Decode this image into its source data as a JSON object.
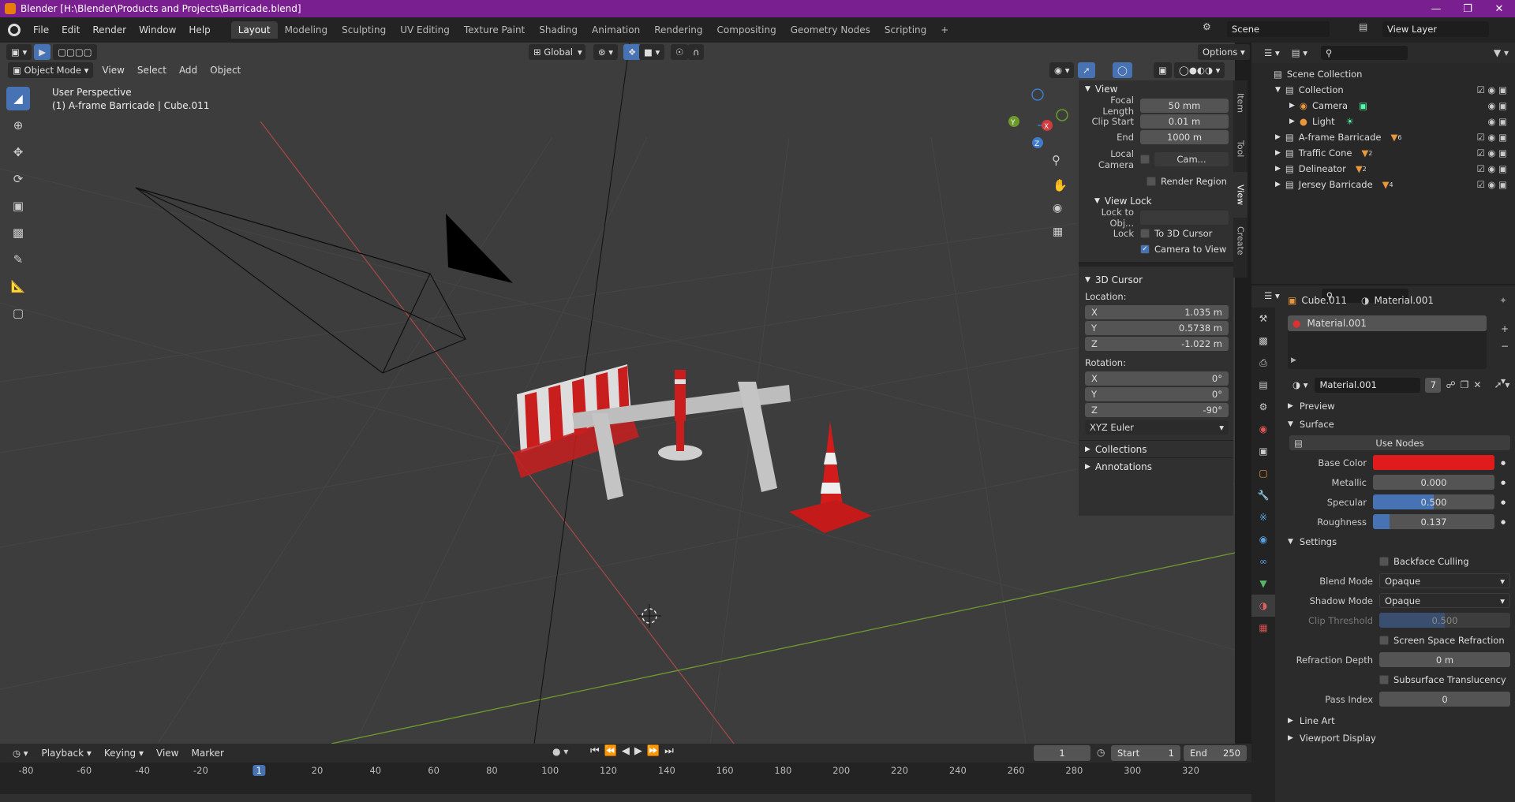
{
  "window": {
    "title": "Blender [H:\\Blender\\Products and Projects\\Barricade.blend]"
  },
  "menu": {
    "items": [
      "File",
      "Edit",
      "Render",
      "Window",
      "Help"
    ]
  },
  "workspaces": {
    "tabs": [
      "Layout",
      "Modeling",
      "Sculpting",
      "UV Editing",
      "Texture Paint",
      "Shading",
      "Animation",
      "Rendering",
      "Compositing",
      "Geometry Nodes",
      "Scripting"
    ],
    "active": "Layout",
    "add": "+"
  },
  "scene": {
    "name": "Scene",
    "view_layer": "View Layer"
  },
  "viewport_header": {
    "transform_orientation": "Global",
    "options": "Options",
    "mode": "Object Mode",
    "menus": [
      "View",
      "Select",
      "Add",
      "Object"
    ]
  },
  "viewport": {
    "perspective": "User Perspective",
    "object_info": "(1) A-frame Barricade | Cube.011"
  },
  "npanel": {
    "tabs": [
      "Item",
      "Tool",
      "View",
      "Create"
    ],
    "view": {
      "title": "View",
      "focal_length_label": "Focal Length",
      "focal_length": "50 mm",
      "clip_start_label": "Clip Start",
      "clip_start": "0.01 m",
      "end_label": "End",
      "end": "1000 m",
      "local_camera_label": "Local Camera",
      "local_camera_value": "Cam...",
      "render_region": "Render Region"
    },
    "view_lock": {
      "title": "View Lock",
      "lock_to_obj_label": "Lock to Obj...",
      "lock_label": "Lock",
      "to_3d_cursor": "To 3D Cursor",
      "camera_to_view": "Camera to View"
    },
    "cursor": {
      "title": "3D Cursor",
      "location_label": "Location:",
      "x_label": "X",
      "x": "1.035 m",
      "y_label": "Y",
      "y": "0.5738 m",
      "z_label": "Z",
      "z": "-1.022 m",
      "rotation_label": "Rotation:",
      "rx": "0°",
      "ry": "0°",
      "rz": "-90°",
      "euler": "XYZ Euler"
    },
    "collections": "Collections",
    "annotations": "Annotations"
  },
  "outliner": {
    "items": [
      {
        "label": "Scene Collection",
        "indent": 0
      },
      {
        "label": "Collection",
        "indent": 1
      },
      {
        "label": "Camera",
        "indent": 2
      },
      {
        "label": "Light",
        "indent": 2
      },
      {
        "label": "A-frame Barricade",
        "indent": 1,
        "count": "6"
      },
      {
        "label": "Traffic Cone",
        "indent": 1,
        "count": "2"
      },
      {
        "label": "Delineator",
        "indent": 1,
        "count": "2"
      },
      {
        "label": "Jersey Barricade",
        "indent": 1,
        "count": "4"
      }
    ]
  },
  "properties": {
    "object": "Cube.011",
    "material": "Material.001",
    "slot": "Material.001",
    "material_field": "Material.001",
    "users": "7",
    "preview": "Preview",
    "surface": "Surface",
    "use_nodes": "Use Nodes",
    "base_color_label": "Base Color",
    "base_color": "#e01b1b",
    "metallic_label": "Metallic",
    "metallic": "0.000",
    "specular_label": "Specular",
    "specular": "0.500",
    "roughness_label": "Roughness",
    "roughness": "0.137",
    "settings": "Settings",
    "backface_culling": "Backface Culling",
    "blend_mode_label": "Blend Mode",
    "blend_mode": "Opaque",
    "shadow_mode_label": "Shadow Mode",
    "shadow_mode": "Opaque",
    "clip_threshold_label": "Clip Threshold",
    "clip_threshold": "0.500",
    "screen_space_refraction": "Screen Space Refraction",
    "refraction_depth_label": "Refraction Depth",
    "refraction_depth": "0 m",
    "subsurface_translucency": "Subsurface Translucency",
    "pass_index_label": "Pass Index",
    "pass_index": "0",
    "line_art": "Line Art",
    "viewport_display": "Viewport Display"
  },
  "timeline": {
    "menus": [
      "Playback",
      "Keying",
      "View",
      "Marker"
    ],
    "current_frame": "1",
    "start_label": "Start",
    "start": "1",
    "end_label": "End",
    "end": "250",
    "ruler": [
      "-80",
      "-60",
      "-40",
      "-20",
      "1",
      "20",
      "40",
      "60",
      "80",
      "100",
      "120",
      "140",
      "160",
      "180",
      "200",
      "220",
      "240",
      "260",
      "280",
      "300",
      "320"
    ]
  }
}
